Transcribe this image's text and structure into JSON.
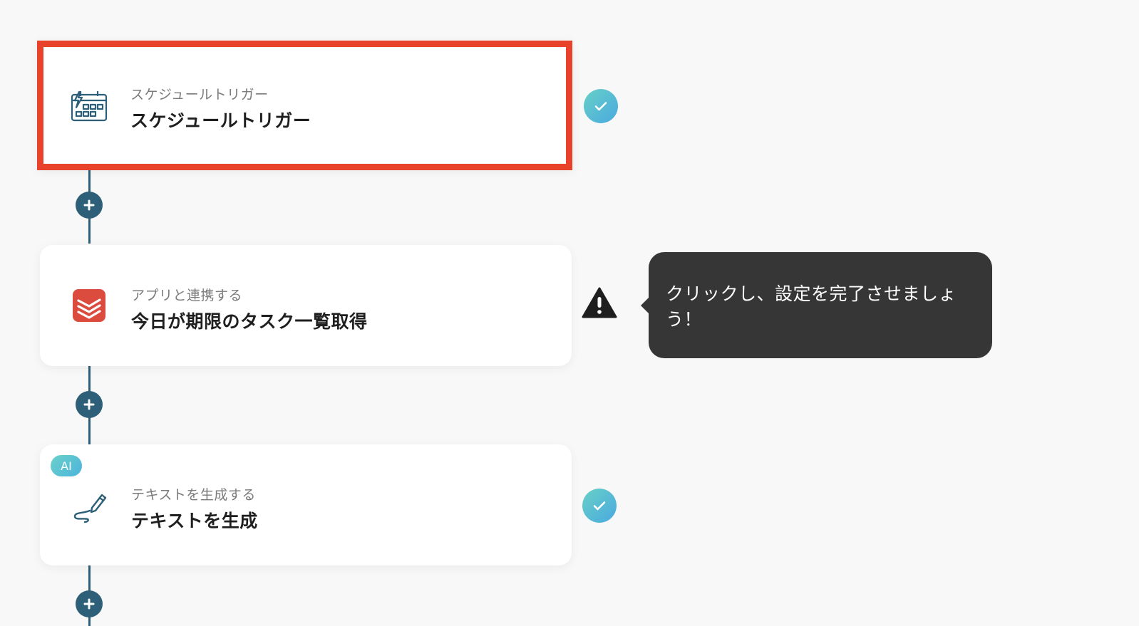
{
  "steps": [
    {
      "subtitle": "スケジュールトリガー",
      "title": "スケジュールトリガー",
      "icon": "calendar-trigger-icon",
      "status": "complete"
    },
    {
      "subtitle": "アプリと連携する",
      "title": "今日が期限のタスク一覧取得",
      "icon": "todoist-icon",
      "status": "warning"
    },
    {
      "subtitle": "テキストを生成する",
      "title": "テキストを生成",
      "icon": "pen-icon",
      "badge": "AI",
      "status": "complete"
    }
  ],
  "tooltip": {
    "text": "クリックし、設定を完了させましょう！"
  },
  "colors": {
    "connector": "#2e5f78",
    "highlight_border": "#e8432a",
    "todoist": "#db4c3f",
    "tooltip_bg": "#363636",
    "status_gradient_start": "#68d0c6",
    "status_gradient_end": "#4aa9e0"
  }
}
